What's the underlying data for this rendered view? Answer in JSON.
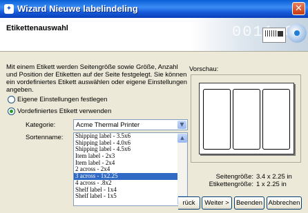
{
  "window": {
    "title": "Wizard Nieuwe labelindeling",
    "icon": "wizard-app-icon"
  },
  "header": {
    "title": "Etikettenauswahl",
    "art_digits": "0011 01",
    "icons": [
      "barcode-label-icon",
      "magic-wand-icon"
    ]
  },
  "intro_text": "Mit einem Etikett werden Seitengröße sowie Größe, Anzahl und Position der Etiketten auf der Seite festgelegt. Sie können ein vordefiniertes Etikett auswählen oder eigene Einstellungen angeben.",
  "options": {
    "custom": {
      "label": "Eigene Einstellungen festlegen",
      "selected": false
    },
    "predefined": {
      "label": "Vordefiniertes Etikett verwenden",
      "selected": true
    }
  },
  "category": {
    "label": "Kategorie:",
    "value": "Acme Thermal Printer"
  },
  "sort_name": {
    "label": "Sortenname:",
    "items": [
      "Shipping label - 3.5x6",
      "Shipping label - 4.0x6",
      "Shipping label - 4.5x6",
      "Item label - 2x3",
      "Item label - 2x4",
      "2 across - 2x4",
      "3 across - 1x2.25",
      "4 across - .8x2",
      "Shelf label - 1x4",
      "Shelf label - 1x5"
    ],
    "selected_index": 6
  },
  "preview": {
    "label": "Vorschau:",
    "page_size_label": "Seitengröße:",
    "page_size_value": "3.4 x 2.25 in",
    "label_size_label": "Etikettengröße:",
    "label_size_value": "1 x 2.25 in",
    "labels_across": 3
  },
  "buttons": {
    "back": "rück",
    "next": "Weiter >",
    "finish": "Beenden",
    "cancel": "Abbrechen"
  }
}
